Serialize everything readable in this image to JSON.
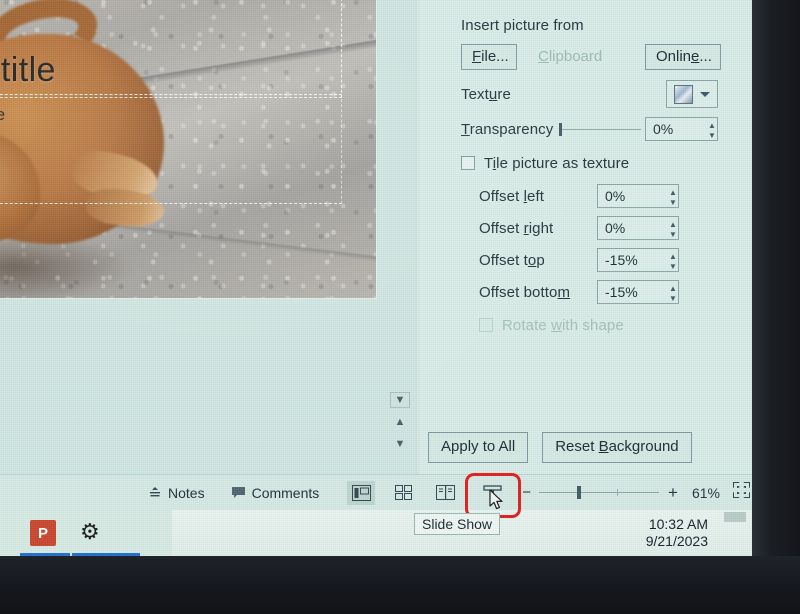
{
  "app": {
    "name": "Microsoft PowerPoint",
    "taskbar_app_initial": "P"
  },
  "slide": {
    "title_placeholder": "o add title",
    "subtitle_placeholder": "o add subtitle"
  },
  "scroll": {
    "collapse_icon": "chevron-down",
    "previous_slide_icon": "double-chevron-up",
    "next_slide_icon": "double-chevron-down"
  },
  "pane": {
    "insert_from_label": "Insert picture from",
    "buttons": {
      "file": "File...",
      "clipboard": "Clipboard",
      "online": "Online..."
    },
    "texture_label": "Texture",
    "transparency_label": "Transparency",
    "transparency_value": "0%",
    "tile_checkbox_label": "Tile picture as texture",
    "tile_checked": false,
    "offsets": [
      {
        "label": "Offset left",
        "value": "0%"
      },
      {
        "label": "Offset right",
        "value": "0%"
      },
      {
        "label": "Offset top",
        "value": "-15%"
      },
      {
        "label": "Offset bottom",
        "value": "-15%"
      }
    ],
    "rotate_label": "Rotate with shape",
    "rotate_checked": false,
    "apply_to_all": "Apply to All",
    "reset_background": "Reset Background"
  },
  "statusbar": {
    "notes": "Notes",
    "comments": "Comments",
    "views": [
      {
        "name": "normal-view",
        "icon": "normal-view-icon",
        "active": true
      },
      {
        "name": "slide-sorter-view",
        "icon": "slide-sorter-icon",
        "active": false
      },
      {
        "name": "reading-view",
        "icon": "reading-view-icon",
        "active": false
      },
      {
        "name": "slide-show",
        "icon": "slide-show-icon",
        "active": false
      }
    ],
    "zoom_out": "−",
    "zoom_in": "+",
    "zoom_level": "61%",
    "fit_icon": "fit-slide-icon",
    "tooltip": "Slide Show"
  },
  "taskbar": {
    "time": "10:32 AM",
    "date": "9/21/2023"
  },
  "colors": {
    "pane_background": "#d8ece7",
    "highlight": "#e11d1d",
    "accent_blue": "#1d6fd0",
    "powerpoint_red": "#c9472e"
  }
}
